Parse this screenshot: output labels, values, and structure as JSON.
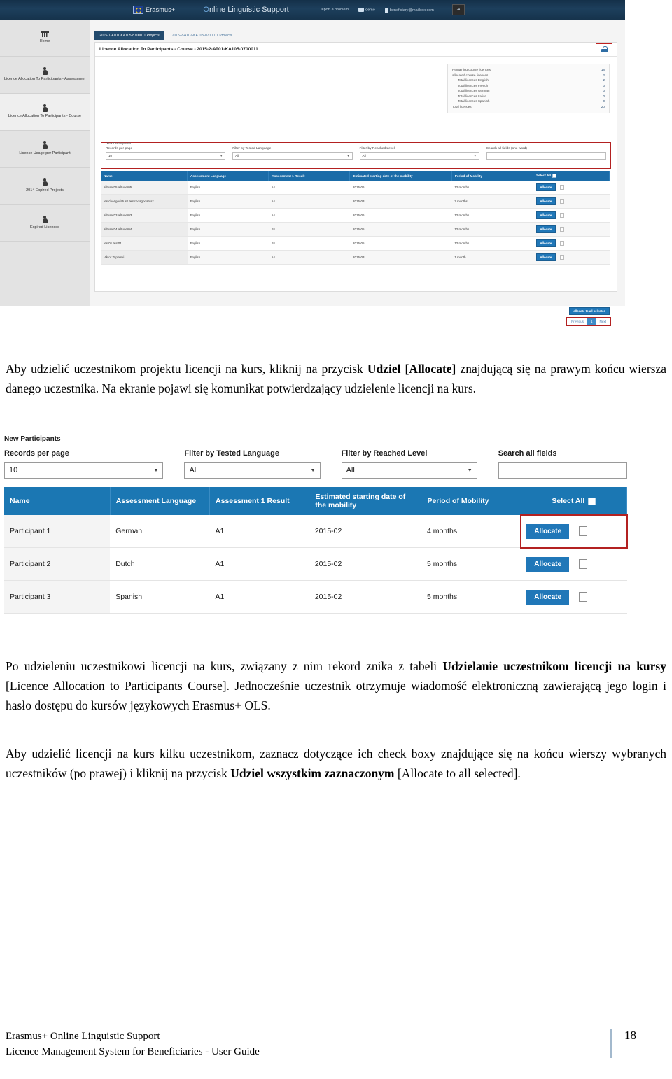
{
  "screenshot_top": {
    "topbar": {
      "logo_text": "Erasmus+",
      "app_title_prefix": "O",
      "app_title": "nline Linguistic Support",
      "links": [
        {
          "label": "report a problem",
          "icon": "none"
        },
        {
          "label": "demo",
          "icon": "users-icon"
        },
        {
          "label": "beneficiary@mailbox.com",
          "icon": "user-icon"
        }
      ],
      "logout_icon": "logout-icon"
    },
    "sidebar": {
      "items": [
        {
          "label": "Home",
          "icon": "home-icon",
          "active": false
        },
        {
          "label": "Licence Allocation To Participants - Assessment",
          "icon": "person-icon",
          "active": false
        },
        {
          "label": "Licence Allocation To Participants - Course",
          "icon": "person-icon",
          "active": true
        },
        {
          "label": "Licence Usage per Participant",
          "icon": "person-icon",
          "active": false
        },
        {
          "label": "2014 Expired Projects",
          "icon": "person-icon",
          "active": false
        },
        {
          "label": "Expired Licences",
          "icon": "person-icon",
          "active": false
        }
      ]
    },
    "tabs": [
      {
        "label": "2015-1-AT01-KA105-8700011 Projects",
        "selected": true
      },
      {
        "label": "2015-2-AT02-KA105-0700011 Projects",
        "selected": false
      }
    ],
    "panel_title": "Licence Allocation To Participants - Course - 2015-2-AT01-KA105-0700011",
    "lock_icon": "lock-icon",
    "summary": [
      {
        "label": "Remaining course licences",
        "value": "18",
        "indent": false
      },
      {
        "label": "allocated course licences",
        "value": "2",
        "indent": false
      },
      {
        "label": "Total licences English",
        "value": "2",
        "indent": true
      },
      {
        "label": "Total licences French",
        "value": "0",
        "indent": true
      },
      {
        "label": "Total licences German",
        "value": "0",
        "indent": true
      },
      {
        "label": "Total licences Italian",
        "value": "0",
        "indent": true
      },
      {
        "label": "Total licences Spanish",
        "value": "0",
        "indent": true
      },
      {
        "label": "Total licences",
        "value": "20",
        "indent": false
      }
    ],
    "filters": {
      "section_label": "New Participants",
      "records_label": "Records per page",
      "records_value": "10",
      "tested_language_label": "Filter by Tested Language",
      "tested_language_value": "All",
      "reached_level_label": "Filter by Reached Level",
      "reached_level_value": "All",
      "search_label": "Search all fields (one word)",
      "search_value": ""
    },
    "table": {
      "headers": [
        "Name",
        "Assessment Language",
        "Assessment 1 Result",
        "Estimated starting date of the mobility",
        "Period of Mobility",
        "Select All"
      ],
      "rows": [
        {
          "name": "alltuser05 alltuser05",
          "language": "English",
          "result": "A1",
          "date": "2015-06",
          "period": "12 months",
          "action": "Allocate"
        },
        {
          "name": "testchoagodatusz testchoagodatusz",
          "language": "English",
          "result": "A1",
          "date": "2015-03",
          "period": "7 months",
          "action": "Allocate"
        },
        {
          "name": "alltuser03 alltuser03",
          "language": "English",
          "result": "A1",
          "date": "2015-06",
          "period": "12 months",
          "action": "Allocate"
        },
        {
          "name": "alltuser04 alltuser04",
          "language": "English",
          "result": "B1",
          "date": "2015-05",
          "period": "12 months",
          "action": "Allocate"
        },
        {
          "name": "test01 test01",
          "language": "English",
          "result": "B1",
          "date": "2015-05",
          "period": "12 months",
          "action": "Allocate"
        },
        {
          "name": "Viktor Taporski",
          "language": "English",
          "result": "A1",
          "date": "2015-03",
          "period": "1 month",
          "action": "Allocate"
        }
      ]
    },
    "allocate_all_label": "allocate to all selected",
    "pagination": {
      "previous": "Previous",
      "current": "1",
      "next": "Next"
    }
  },
  "paragraph_1": {
    "part1": "Aby udzielić uczestnikom projektu licencji na kurs, kliknij na przycisk ",
    "bold1": "Udziel [Allocate]",
    "part2": " znajdującą się na prawym końcu wiersza danego uczestnika. Na ekranie pojawi się komunikat potwierdzający udzielenie licencji na kurs."
  },
  "screenshot_bottom": {
    "section_label": "New Participants",
    "filters": {
      "records_label": "Records per page",
      "records_value": "10",
      "tested_language_label": "Filter by Tested Language",
      "tested_language_value": "All",
      "reached_level_label": "Filter by Reached Level",
      "reached_level_value": "All",
      "search_label": "Search all fields",
      "search_value": ""
    },
    "table": {
      "headers": [
        "Name",
        "Assessment Language",
        "Assessment 1 Result",
        "Estimated starting date of the mobility",
        "Period of Mobility",
        "Select All"
      ],
      "rows": [
        {
          "name": "Participant 1",
          "language": "German",
          "result": "A1",
          "date": "2015-02",
          "period": "4 months",
          "action": "Allocate",
          "highlighted": true
        },
        {
          "name": "Participant 2",
          "language": "Dutch",
          "result": "A1",
          "date": "2015-02",
          "period": "5 months",
          "action": "Allocate",
          "highlighted": false
        },
        {
          "name": "Participant 3",
          "language": "Spanish",
          "result": "A1",
          "date": "2015-02",
          "period": "5 months",
          "action": "Allocate",
          "highlighted": false
        }
      ]
    }
  },
  "paragraph_2": {
    "part1": "Po udzieleniu uczestnikowi licencji na kurs, związany z nim rekord znika z tabeli ",
    "bold1": "Udzielanie uczestnikom licencji na kursy",
    "part2": " [Licence Allocation to Participants Course]. Jednocześnie uczestnik otrzymuje wiadomość elektroniczną zawierającą jego login i hasło dostępu do kursów językowych Erasmus+ OLS."
  },
  "paragraph_3": {
    "part1": "Aby udzielić licencji na kurs kilku uczestnikom, zaznacz dotyczące ich check boxy znajdujące się na końcu wierszy wybranych uczestników (po prawej) i kliknij na przycisk ",
    "bold1": "Udziel wszystkim zaznaczonym",
    "part2": " [Allocate to all selected]."
  },
  "footer": {
    "line1": "Erasmus+ Online Linguistic Support",
    "line2": "Licence Management System for Beneficiaries - User Guide",
    "page": "18"
  },
  "colors": {
    "header_blue": "#1b6ca8",
    "topbar_navy": "#143049",
    "accent_red": "#b32121",
    "button_blue": "#2077b8"
  }
}
